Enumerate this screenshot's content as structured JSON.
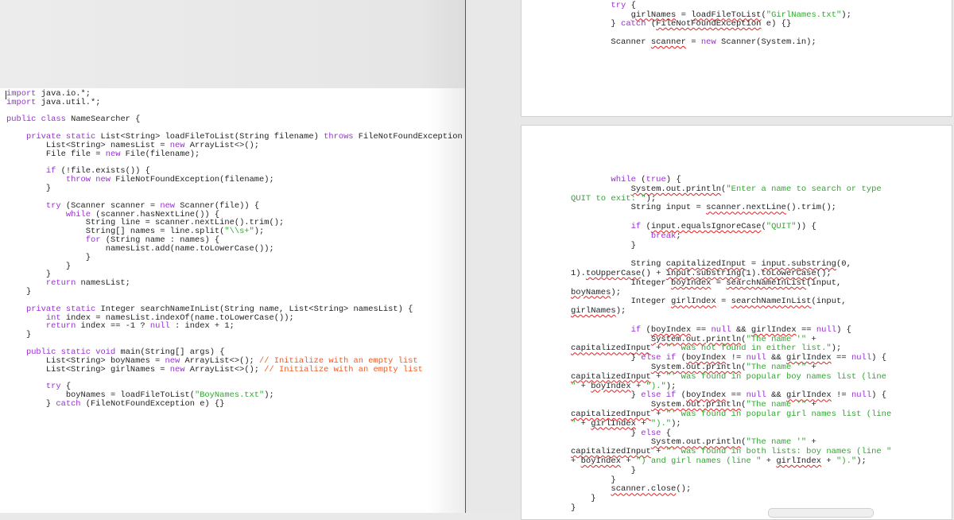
{
  "colors": {
    "keyword": "#9b2fd6",
    "string": "#2ea82e",
    "comment": "#ef5b25",
    "error_underline": "#e02020"
  },
  "code": {
    "left": [
      [
        [
          "import",
          "k"
        ],
        [
          " java.io.*;",
          ""
        ]
      ],
      [
        [
          "import",
          "k"
        ],
        [
          " java.util.*;",
          ""
        ]
      ],
      [],
      [
        [
          "public",
          "k"
        ],
        [
          " ",
          ""
        ],
        [
          "class",
          "k"
        ],
        [
          " NameSearcher {",
          ""
        ]
      ],
      [],
      [
        [
          "    ",
          ""
        ],
        [
          "private",
          "k"
        ],
        [
          " ",
          ""
        ],
        [
          "static",
          "k"
        ],
        [
          " List<String> loadFileToList(String filename) ",
          ""
        ],
        [
          "throws",
          "k"
        ],
        [
          " FileNotFoundException",
          ""
        ]
      ],
      [
        [
          "        List<String> namesList = ",
          ""
        ],
        [
          "new",
          "k"
        ],
        [
          " ArrayList<>();",
          ""
        ]
      ],
      [
        [
          "        File file = ",
          ""
        ],
        [
          "new",
          "k"
        ],
        [
          " File(filename);",
          ""
        ]
      ],
      [],
      [
        [
          "        ",
          ""
        ],
        [
          "if",
          "k"
        ],
        [
          " (!file.exists()) {",
          ""
        ]
      ],
      [
        [
          "            ",
          ""
        ],
        [
          "throw",
          "k"
        ],
        [
          " ",
          ""
        ],
        [
          "new",
          "k"
        ],
        [
          " FileNotFoundException(filename);",
          ""
        ]
      ],
      [
        [
          "        }",
          ""
        ]
      ],
      [],
      [
        [
          "        ",
          ""
        ],
        [
          "try",
          "k"
        ],
        [
          " (Scanner scanner = ",
          ""
        ],
        [
          "new",
          "k"
        ],
        [
          " Scanner(file)) {",
          ""
        ]
      ],
      [
        [
          "            ",
          ""
        ],
        [
          "while",
          "k"
        ],
        [
          " (scanner.hasNextLine()) {",
          ""
        ]
      ],
      [
        [
          "                String line = scanner.nextLine().trim();",
          ""
        ]
      ],
      [
        [
          "                String[] names = line.split(",
          ""
        ],
        [
          "\"\\\\s+\"",
          "s"
        ],
        [
          ");",
          ""
        ]
      ],
      [
        [
          "                ",
          ""
        ],
        [
          "for",
          "k"
        ],
        [
          " (String name : names) {",
          ""
        ]
      ],
      [
        [
          "                    namesList.add(name.toLowerCase());",
          ""
        ]
      ],
      [
        [
          "                }",
          ""
        ]
      ],
      [
        [
          "            }",
          ""
        ]
      ],
      [
        [
          "        }",
          ""
        ]
      ],
      [
        [
          "        ",
          ""
        ],
        [
          "return",
          "k"
        ],
        [
          " namesList;",
          ""
        ]
      ],
      [
        [
          "    }",
          ""
        ]
      ],
      [],
      [
        [
          "    ",
          ""
        ],
        [
          "private",
          "k"
        ],
        [
          " ",
          ""
        ],
        [
          "static",
          "k"
        ],
        [
          " Integer searchNameInList(String name, List<String> namesList) {",
          ""
        ]
      ],
      [
        [
          "        ",
          ""
        ],
        [
          "int",
          "k"
        ],
        [
          " index = namesList.indexOf(name.toLowerCase());",
          ""
        ]
      ],
      [
        [
          "        ",
          ""
        ],
        [
          "return",
          "k"
        ],
        [
          " index == -1 ? ",
          ""
        ],
        [
          "null",
          "k"
        ],
        [
          " : index + 1;",
          ""
        ]
      ],
      [
        [
          "    }",
          ""
        ]
      ],
      [],
      [
        [
          "    ",
          ""
        ],
        [
          "public",
          "k"
        ],
        [
          " ",
          ""
        ],
        [
          "static",
          "k"
        ],
        [
          " ",
          ""
        ],
        [
          "void",
          "k"
        ],
        [
          " main(String[] args) {",
          ""
        ]
      ],
      [
        [
          "        List<String> boyNames = ",
          ""
        ],
        [
          "new",
          "k"
        ],
        [
          " ArrayList<>(); ",
          ""
        ],
        [
          "// Initialize with an empty list",
          "c"
        ]
      ],
      [
        [
          "        List<String> girlNames = ",
          ""
        ],
        [
          "new",
          "k"
        ],
        [
          " ArrayList<>(); ",
          ""
        ],
        [
          "// Initialize with an empty list",
          "c"
        ]
      ],
      [],
      [
        [
          "        ",
          ""
        ],
        [
          "try",
          "k"
        ],
        [
          " {",
          ""
        ]
      ],
      [
        [
          "            boyNames = loadFileToList(",
          ""
        ],
        [
          "\"BoyNames.txt\"",
          "s"
        ],
        [
          ");",
          ""
        ]
      ],
      [
        [
          "        } ",
          ""
        ],
        [
          "catch",
          "k"
        ],
        [
          " (FileNotFoundException e) {}",
          ""
        ]
      ]
    ],
    "right_top": [
      [
        [
          "        ",
          ""
        ],
        [
          "try",
          "k"
        ],
        [
          " {",
          ""
        ]
      ],
      [
        [
          "            ",
          ""
        ],
        [
          "girlNames",
          "e"
        ],
        [
          " = ",
          ""
        ],
        [
          "loadFileToList",
          "e"
        ],
        [
          "(",
          ""
        ],
        [
          "\"GirlNames.txt\"",
          "s"
        ],
        [
          ");",
          ""
        ]
      ],
      [
        [
          "        } ",
          ""
        ],
        [
          "catch",
          "k"
        ],
        [
          " (",
          ""
        ],
        [
          "FileNotFoundException",
          "e"
        ],
        [
          " e) {}",
          ""
        ]
      ],
      [],
      [
        [
          "        Scanner ",
          ""
        ],
        [
          "scanner",
          "e"
        ],
        [
          " = ",
          ""
        ],
        [
          "new",
          "k"
        ],
        [
          " Scanner(System.in);",
          ""
        ]
      ]
    ],
    "right_bottom": [
      [
        [
          "        ",
          ""
        ],
        [
          "while",
          "k"
        ],
        [
          " (",
          ""
        ],
        [
          "true",
          "k"
        ],
        [
          ") {",
          ""
        ]
      ],
      [
        [
          "            ",
          ""
        ],
        [
          "System.out.println",
          "e"
        ],
        [
          "(",
          ""
        ],
        [
          "\"Enter a name to search or type",
          "s"
        ]
      ],
      [
        [
          "QUIT to exit: \"",
          "s"
        ],
        [
          ");",
          ""
        ]
      ],
      [
        [
          "            String input = ",
          ""
        ],
        [
          "scanner.nextLine",
          "e"
        ],
        [
          "().trim();",
          ""
        ]
      ],
      [],
      [
        [
          "            ",
          ""
        ],
        [
          "if",
          "k"
        ],
        [
          " (",
          ""
        ],
        [
          "input.equalsIgnoreCase",
          "e"
        ],
        [
          "(",
          ""
        ],
        [
          "\"QUIT\"",
          "s"
        ],
        [
          ")) {",
          ""
        ]
      ],
      [
        [
          "                ",
          ""
        ],
        [
          "break",
          "k"
        ],
        [
          ";",
          ""
        ]
      ],
      [
        [
          "            }",
          ""
        ]
      ],
      [],
      [
        [
          "            String ",
          ""
        ],
        [
          "capitalizedInput",
          "e"
        ],
        [
          " = ",
          ""
        ],
        [
          "input.substring",
          "e"
        ],
        [
          "(0,",
          ""
        ]
      ],
      [
        [
          "1).",
          ""
        ],
        [
          "toUpperCase",
          "e"
        ],
        [
          "() + ",
          ""
        ],
        [
          "input.substring",
          "e"
        ],
        [
          "(1).",
          ""
        ],
        [
          "toLowerCase",
          "e"
        ],
        [
          "();",
          ""
        ]
      ],
      [
        [
          "            Integer ",
          ""
        ],
        [
          "boyIndex",
          "e"
        ],
        [
          " = ",
          ""
        ],
        [
          "searchNameInList",
          "e"
        ],
        [
          "(input,",
          ""
        ]
      ],
      [
        [
          "boyNames",
          "e"
        ],
        [
          ");",
          ""
        ]
      ],
      [
        [
          "            Integer ",
          ""
        ],
        [
          "girlIndex",
          "e"
        ],
        [
          " = ",
          ""
        ],
        [
          "searchNameInList",
          "e"
        ],
        [
          "(input,",
          ""
        ]
      ],
      [
        [
          "girlNames",
          "e"
        ],
        [
          ");",
          ""
        ]
      ],
      [],
      [
        [
          "            ",
          ""
        ],
        [
          "if",
          "k"
        ],
        [
          " (",
          ""
        ],
        [
          "boyIndex",
          "e"
        ],
        [
          " == ",
          ""
        ],
        [
          "null",
          "k"
        ],
        [
          " && ",
          ""
        ],
        [
          "girlIndex",
          "e"
        ],
        [
          " == ",
          ""
        ],
        [
          "null",
          "k"
        ],
        [
          ") {",
          ""
        ]
      ],
      [
        [
          "                ",
          ""
        ],
        [
          "System.out.println",
          "e"
        ],
        [
          "(",
          ""
        ],
        [
          "\"The name '\"",
          "s"
        ],
        [
          " +",
          ""
        ]
      ],
      [
        [
          "capitalizedInput",
          "e"
        ],
        [
          " + ",
          ""
        ],
        [
          "\"' was not found in either list.\"",
          "s"
        ],
        [
          ");",
          ""
        ]
      ],
      [
        [
          "            } ",
          ""
        ],
        [
          "else if",
          "k"
        ],
        [
          " (",
          ""
        ],
        [
          "boyIndex",
          "e"
        ],
        [
          " != ",
          ""
        ],
        [
          "null",
          "k"
        ],
        [
          " && ",
          ""
        ],
        [
          "girlIndex",
          "e"
        ],
        [
          " == ",
          ""
        ],
        [
          "null",
          "k"
        ],
        [
          ") {",
          ""
        ]
      ],
      [
        [
          "                ",
          ""
        ],
        [
          "System.out.println",
          "e"
        ],
        [
          "(",
          ""
        ],
        [
          "\"The name '\"",
          "s"
        ],
        [
          " +",
          ""
        ]
      ],
      [
        [
          "capitalizedInput",
          "e"
        ],
        [
          " + ",
          ""
        ],
        [
          "\"' was found in popular boy names list (line",
          "s"
        ]
      ],
      [
        [
          "\"",
          "s"
        ],
        [
          " + ",
          ""
        ],
        [
          "boyIndex",
          "e"
        ],
        [
          " + ",
          ""
        ],
        [
          "\").\"",
          "s"
        ],
        [
          ");",
          ""
        ]
      ],
      [
        [
          "            } ",
          ""
        ],
        [
          "else if",
          "k"
        ],
        [
          " (",
          ""
        ],
        [
          "boyIndex",
          "e"
        ],
        [
          " == ",
          ""
        ],
        [
          "null",
          "k"
        ],
        [
          " && ",
          ""
        ],
        [
          "girlIndex",
          "e"
        ],
        [
          " != ",
          ""
        ],
        [
          "null",
          "k"
        ],
        [
          ") {",
          ""
        ]
      ],
      [
        [
          "                ",
          ""
        ],
        [
          "System.out.println",
          "e"
        ],
        [
          "(",
          ""
        ],
        [
          "\"The name '\"",
          "s"
        ],
        [
          " +",
          ""
        ]
      ],
      [
        [
          "capitalizedInput",
          "e"
        ],
        [
          " + ",
          ""
        ],
        [
          "\"' was found in popular girl names list (line",
          "s"
        ]
      ],
      [
        [
          "\"",
          "s"
        ],
        [
          " + ",
          ""
        ],
        [
          "girlIndex",
          "e"
        ],
        [
          " + ",
          ""
        ],
        [
          "\").\"",
          "s"
        ],
        [
          ");",
          ""
        ]
      ],
      [
        [
          "            } ",
          ""
        ],
        [
          "else",
          "k"
        ],
        [
          " {",
          ""
        ]
      ],
      [
        [
          "                ",
          ""
        ],
        [
          "System.out.println",
          "e"
        ],
        [
          "(",
          ""
        ],
        [
          "\"The name '\"",
          "s"
        ],
        [
          " +",
          ""
        ]
      ],
      [
        [
          "capitalizedInput",
          "e"
        ],
        [
          " + ",
          ""
        ],
        [
          "\"' was found in both lists: boy names (line \"",
          "s"
        ]
      ],
      [
        [
          "+ ",
          ""
        ],
        [
          "boyIndex",
          "e"
        ],
        [
          " + ",
          ""
        ],
        [
          "\") and girl names (line \"",
          "s"
        ],
        [
          " + ",
          ""
        ],
        [
          "girlIndex",
          "e"
        ],
        [
          " + ",
          ""
        ],
        [
          "\").\"",
          "s"
        ],
        [
          ");",
          ""
        ]
      ],
      [
        [
          "            }",
          ""
        ]
      ],
      [
        [
          "        }",
          ""
        ]
      ],
      [
        [
          "        ",
          ""
        ],
        [
          "scanner.close",
          "e"
        ],
        [
          "();",
          ""
        ]
      ],
      [
        [
          "    }",
          ""
        ]
      ],
      [
        [
          "}",
          ""
        ]
      ]
    ]
  }
}
